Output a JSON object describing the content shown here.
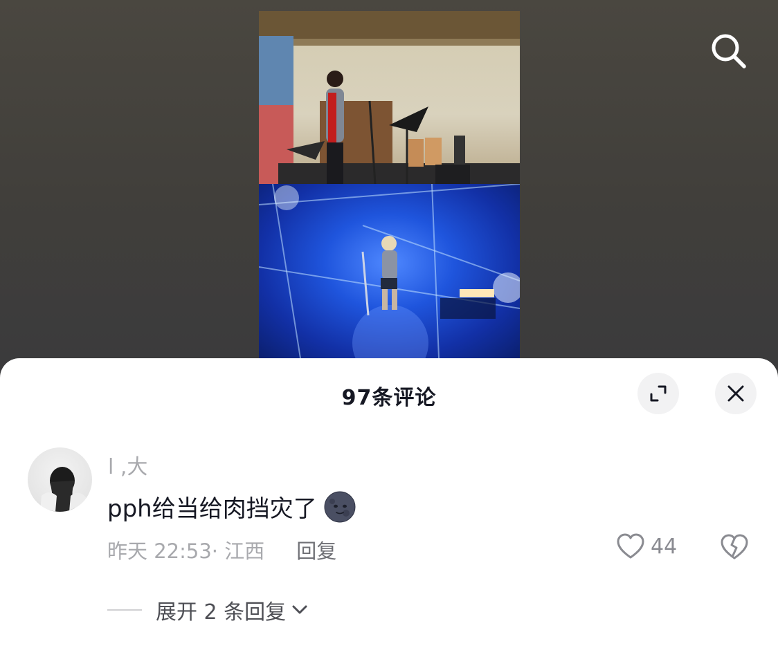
{
  "comments_panel": {
    "title": "97条评论",
    "icons": {
      "expand": "expand-icon",
      "close": "close-icon",
      "search": "search-icon"
    }
  },
  "comment": {
    "username": "l ,大",
    "text": "pph给当给肉挡灾了",
    "emoji": "new-moon-face-emoji",
    "time": "昨天 22:53· 江西",
    "reply_label": "回复",
    "likes": "44",
    "expand_replies": "展开 2 条回复"
  },
  "colors": {
    "title": "#161823",
    "secondary_text": "#a8a9ad",
    "sheet_bg": "#ffffff",
    "background": "#3c3b39"
  }
}
